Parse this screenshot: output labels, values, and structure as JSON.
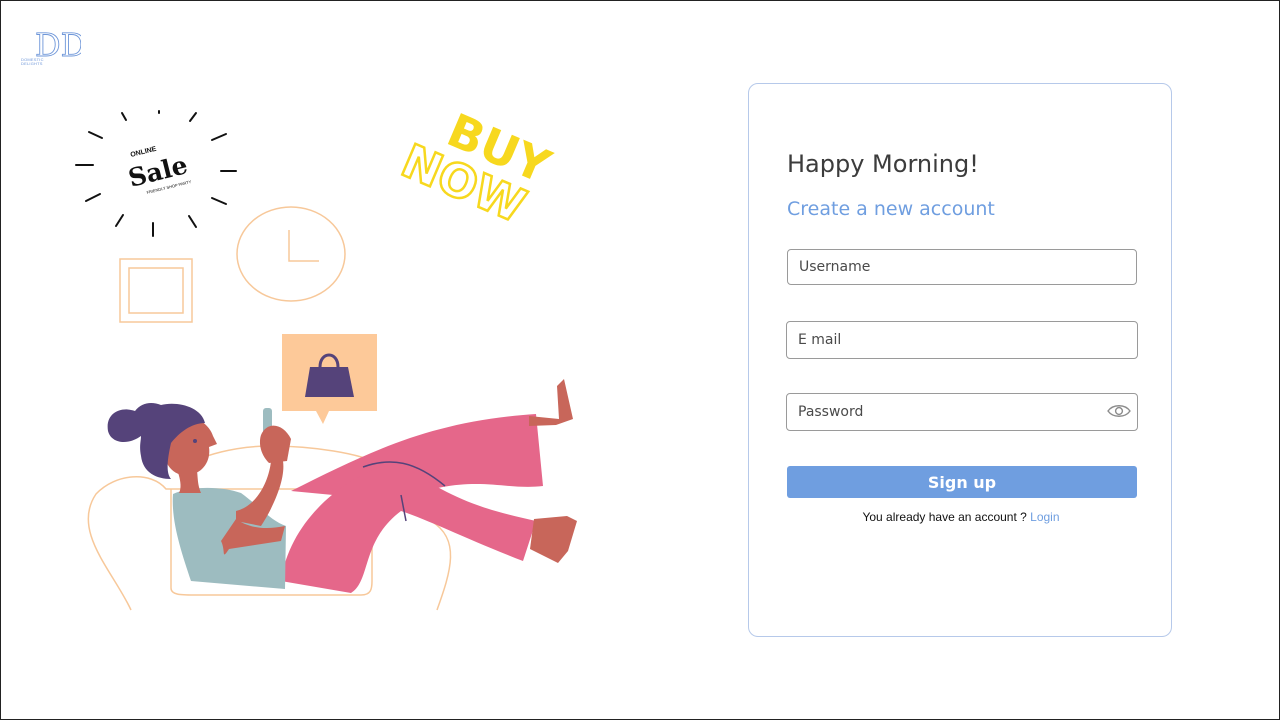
{
  "brand": {
    "logo_letters": "DD",
    "tagline": "DOMESTIC DELIGHTS"
  },
  "illustration": {
    "sale_badge": {
      "top": "ONLINE",
      "main": "Sale",
      "bottom": "FRIENDLY SHOP PARTY"
    },
    "buy_now": {
      "line1": "BUY",
      "line2": "NOW"
    }
  },
  "form": {
    "greeting": "Happy Morning!",
    "subtitle": "Create a new account",
    "username_placeholder": "Username",
    "email_placeholder": "E mail",
    "password_placeholder": "Password",
    "password_toggle_icon": "eye-icon",
    "submit_label": "Sign up",
    "login_prompt": "You already have an account ? ",
    "login_link": "Login"
  },
  "colors": {
    "accent": "#6f9ee0",
    "card_border": "#b6c9ea",
    "buy_now_yellow": "#f7d81e",
    "pants_pink": "#e5678a",
    "hair_purple": "#55437a",
    "skin": "#c8665a",
    "shirt": "#9dbcc0",
    "sofa_outline": "#f7c89a"
  }
}
